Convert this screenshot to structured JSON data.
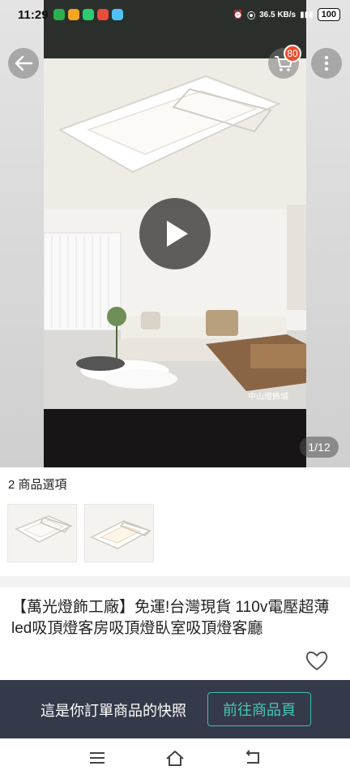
{
  "status_bar": {
    "time": "11:29",
    "battery": "100",
    "net_speed": "36.5 KB/s"
  },
  "header": {
    "back_icon": "arrow-left-icon",
    "cart_icon": "cart-icon",
    "cart_count": "80",
    "more_icon": "more-vertical-icon"
  },
  "media": {
    "play_icon": "play-icon",
    "counter": "1/12",
    "watermark": "中山燈飾城"
  },
  "options": {
    "label": "2 商品選項"
  },
  "product": {
    "title": "【萬光燈飾工廠】免運!台灣現貨 110v電壓超薄led吸頂燈客房吸頂燈臥室吸頂燈客廳",
    "favorite_icon": "heart-icon"
  },
  "snapshot_bar": {
    "text": "這是你訂單商品的快照",
    "button": "前往商品頁"
  },
  "nav": {
    "menu_icon": "menu-icon",
    "home_icon": "home-icon",
    "back_icon": "back-icon"
  },
  "colors": {
    "accent": "#46c7b6",
    "badge": "#ee4d2d",
    "bar": "#353a4a"
  }
}
